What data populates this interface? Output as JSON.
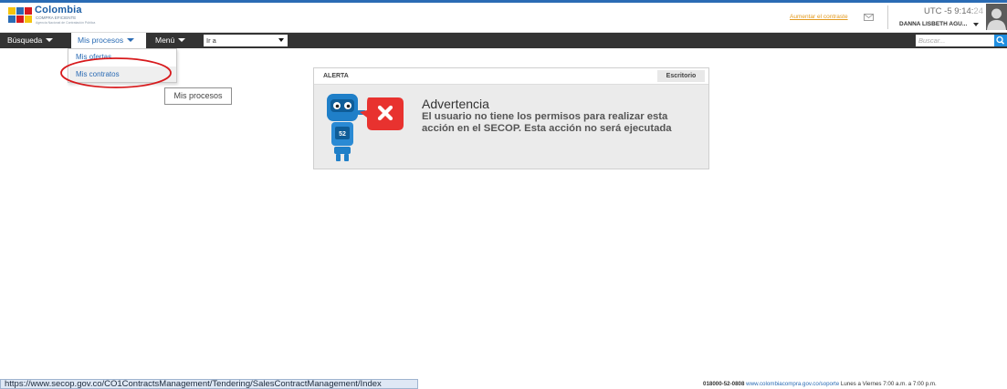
{
  "header": {
    "logo": {
      "name": "Colombia",
      "tagline": "COMPRA EFICIENTE",
      "sub": "Agencia Nacional de Contratación Pública"
    },
    "increase_contrast": "Aumentar el contraste",
    "utc_label": "UTC -5",
    "time_main": "9:14:",
    "time_secs": "24",
    "user_name": "DANNA LISBETH AGU..."
  },
  "nav": {
    "items": [
      {
        "label": "Búsqueda"
      },
      {
        "label": "Mis procesos"
      },
      {
        "label": "Menú"
      }
    ],
    "goto_value": "Ir a",
    "search_placeholder": "Buscar..."
  },
  "dropdown": {
    "items": [
      {
        "label": "Mis ofertas"
      },
      {
        "label": "Mis contratos"
      }
    ],
    "tooltip": "Mis procesos"
  },
  "alert": {
    "title": "ALERTA",
    "tag": "Escritorio",
    "heading": "Advertencia",
    "message": "El usuario no tiene los permisos para realizar esta acción en el SECOP. Esta acción no será ejecutada",
    "robot_badge": "52"
  },
  "footer": {
    "status_url": "https://www.secop.gov.co/CO1ContractsManagement/Tendering/SalesContractManagement/Index",
    "phone": "018000-52-0808",
    "support_link": "www.colombiacompra.gov.co/soporte",
    "hours": "Lunes a Viernes 7:00 a.m. a 7:00 p.m."
  },
  "colors": {
    "nav_bg": "#333333",
    "accent_blue": "#2a6bb4",
    "alert_red": "#e8322f",
    "highlight_ellipse": "#d7191c",
    "contrast_link": "#e39a1f"
  }
}
